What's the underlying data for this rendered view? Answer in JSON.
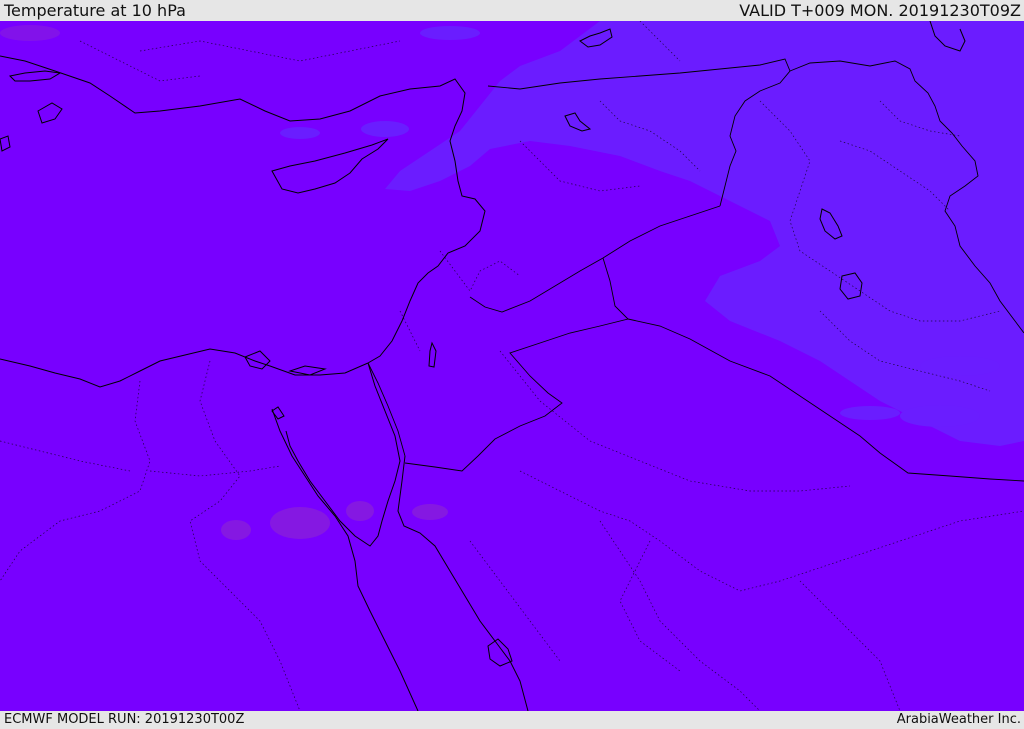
{
  "header": {
    "title": "Temperature at 10 hPa",
    "valid_time": "VALID T+009 MON. 20191230T09Z"
  },
  "footer": {
    "model_run": "ECMWF MODEL RUN: 20191230T00Z",
    "credit": "ArabiaWeather Inc."
  },
  "map": {
    "base_fill_color": "#7800ff",
    "cooler_zone_color": "#6a1dff",
    "warmer_patch_color": "#8a20d8",
    "coastline_color": "#000000",
    "border_style": "dotted"
  }
}
